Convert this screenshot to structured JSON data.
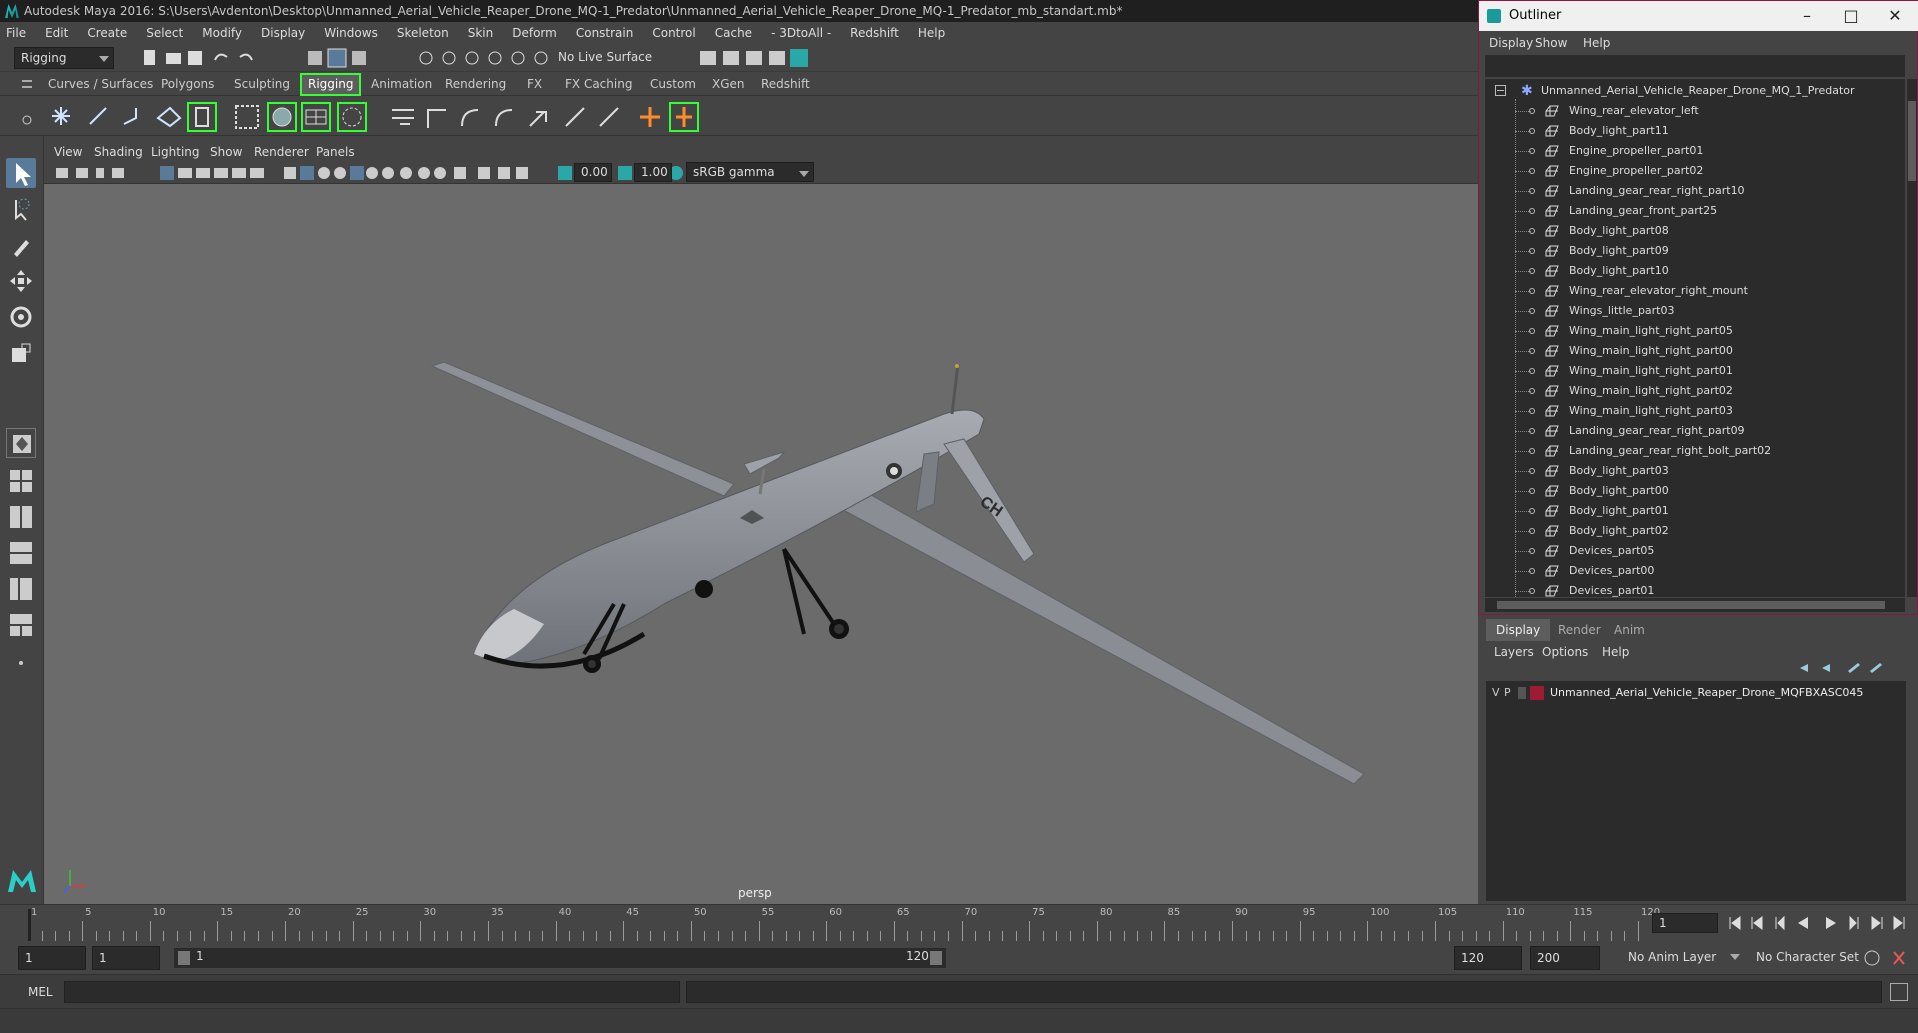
{
  "window": {
    "title": "Autodesk Maya 2016: S:\\Users\\Avdenton\\Desktop\\Unmanned_Aerial_Vehicle_Reaper_Drone_MQ-1_Predator\\Unmanned_Aerial_Vehicle_Reaper_Drone_MQ-1_Predator_mb_standart.mb*"
  },
  "menubar": [
    "File",
    "Edit",
    "Create",
    "Select",
    "Modify",
    "Display",
    "Windows",
    "Skeleton",
    "Skin",
    "Deform",
    "Constrain",
    "Control",
    "Cache",
    "- 3DtoAll -",
    "Redshift",
    "Help"
  ],
  "statusline": {
    "mode": "Rigging",
    "live_surface": "No Live Surface"
  },
  "shelf_tabs": [
    {
      "label": "Curves / Surfaces",
      "active": false
    },
    {
      "label": "Polygons",
      "active": false
    },
    {
      "label": "Sculpting",
      "active": false
    },
    {
      "label": "Rigging",
      "active": true
    },
    {
      "label": "Animation",
      "active": false
    },
    {
      "label": "Rendering",
      "active": false
    },
    {
      "label": "FX",
      "active": false
    },
    {
      "label": "FX Caching",
      "active": false
    },
    {
      "label": "Custom",
      "active": false
    },
    {
      "label": "XGen",
      "active": false
    },
    {
      "label": "Redshift",
      "active": false
    }
  ],
  "viewport": {
    "menu": [
      "View",
      "Shading",
      "Lighting",
      "Show",
      "Renderer",
      "Panels"
    ],
    "exposure": "0.00",
    "gamma": "1.00",
    "color_space": "sRGB gamma",
    "camera": "persp",
    "aircraft_tail_text": "CH"
  },
  "outliner": {
    "title": "Outliner",
    "menu": [
      "Display",
      "Show",
      "Help"
    ],
    "root": "Unmanned_Aerial_Vehicle_Reaper_Drone_MQ_1_Predator",
    "items": [
      "Wing_rear_elevator_left",
      "Body_light_part11",
      "Engine_propeller_part01",
      "Engine_propeller_part02",
      "Landing_gear_rear_right_part10",
      "Landing_gear_front_part25",
      "Body_light_part08",
      "Body_light_part09",
      "Body_light_part10",
      "Wing_rear_elevator_right_mount",
      "Wings_little_part03",
      "Wing_main_light_right_part05",
      "Wing_main_light_right_part00",
      "Wing_main_light_right_part01",
      "Wing_main_light_right_part02",
      "Wing_main_light_right_part03",
      "Landing_gear_rear_right_part09",
      "Landing_gear_rear_right_bolt_part02",
      "Body_light_part03",
      "Body_light_part00",
      "Body_light_part01",
      "Body_light_part02",
      "Devices_part05",
      "Devices_part00",
      "Devices_part01"
    ]
  },
  "layer_editor": {
    "tabs": [
      {
        "label": "Display",
        "active": true
      },
      {
        "label": "Render",
        "active": false
      },
      {
        "label": "Anim",
        "active": false
      }
    ],
    "menu": [
      "Layers",
      "Options",
      "Help"
    ],
    "layer": {
      "v": "V",
      "p": "P",
      "color": "#9e1a35",
      "name": "Unmanned_Aerial_Vehicle_Reaper_Drone_MQFBXASC045"
    }
  },
  "timeline": {
    "ticks": [
      "1",
      "5",
      "10",
      "15",
      "20",
      "25",
      "30",
      "35",
      "40",
      "45",
      "50",
      "55",
      "60",
      "65",
      "70",
      "75",
      "80",
      "85",
      "90",
      "95",
      "100",
      "105",
      "110",
      "115",
      "120"
    ],
    "current_frame": "1"
  },
  "range": {
    "start": "1",
    "playback_start": "1",
    "slider_start": "1",
    "slider_end": "120",
    "playback_end": "120",
    "end": "200",
    "anim_layer": "No Anim Layer",
    "character_set": "No Character Set"
  },
  "command_line": {
    "label": "MEL"
  },
  "colors": {
    "accent_green": "#33ff33",
    "outliner_border": "#8a1646",
    "viewport_bg": "#6b6b6b"
  }
}
